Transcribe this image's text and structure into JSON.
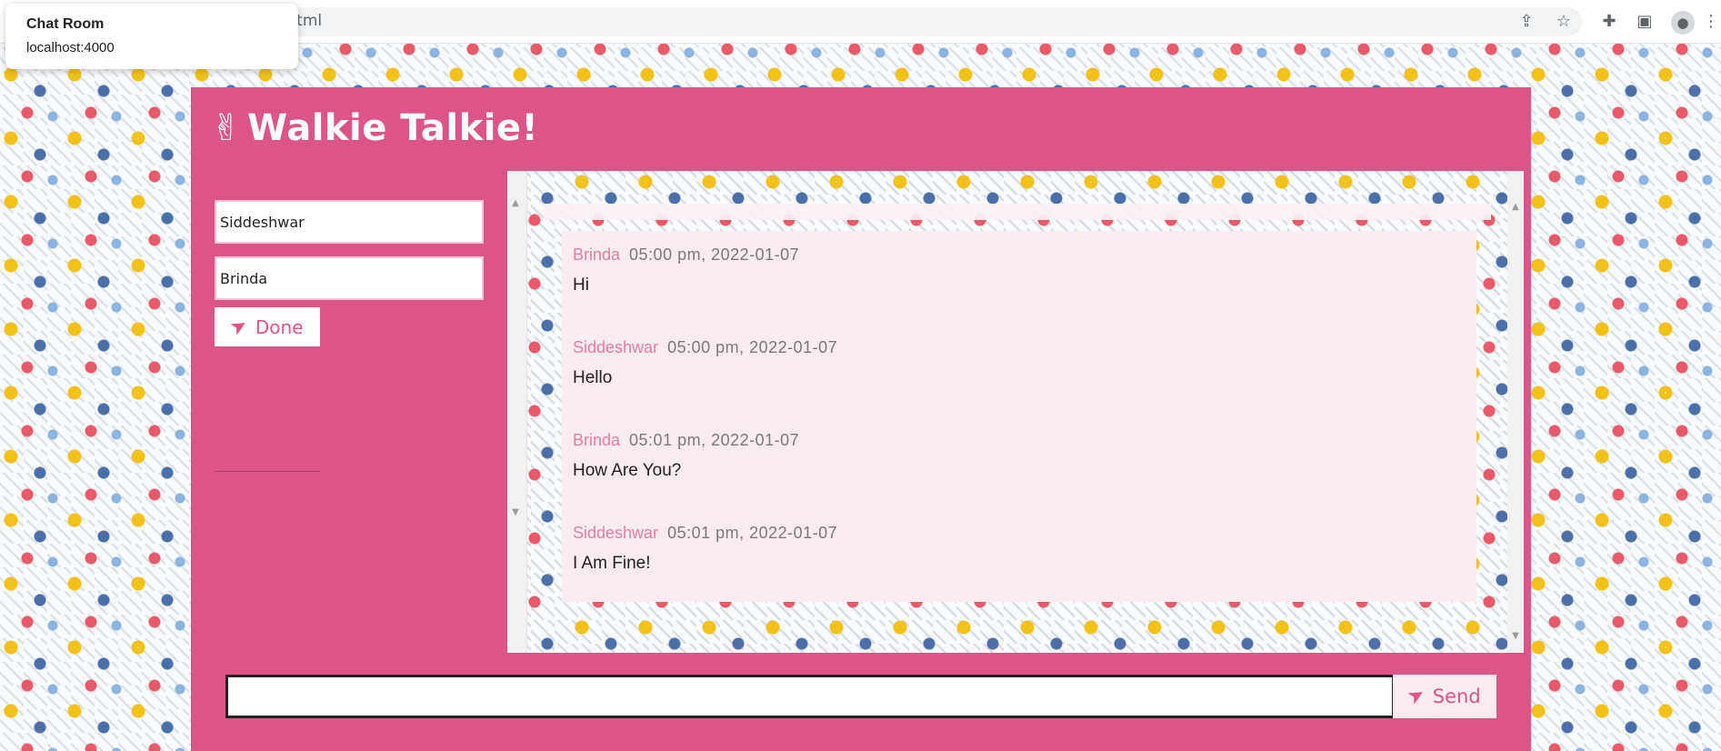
{
  "browser": {
    "address_suffix": ".html",
    "tooltip": {
      "title": "Chat Room",
      "url": "localhost:4000"
    },
    "icons": [
      "share-icon",
      "star-icon",
      "extensions-icon",
      "side-panel-icon",
      "profile-icon",
      "menu-icon"
    ]
  },
  "app": {
    "title": "Walkie Talkie!",
    "logo_icon": "peace-hand-icon",
    "accent_color": "#dd5588",
    "sender_field": {
      "value": "Siddeshwar"
    },
    "receiver_field": {
      "value": "Brinda"
    },
    "done_button": {
      "label": "Done",
      "icon": "send-icon"
    },
    "messages": [
      {
        "name": "Brinda",
        "time": "05:00 pm, 2022-01-07",
        "text": "Hi"
      },
      {
        "name": "Siddeshwar",
        "time": "05:00 pm, 2022-01-07",
        "text": "Hello"
      },
      {
        "name": "Brinda",
        "time": "05:01 pm, 2022-01-07",
        "text": "How Are You?"
      },
      {
        "name": "Siddeshwar",
        "time": "05:01 pm, 2022-01-07",
        "text": "I Am Fine!"
      }
    ],
    "message_input": {
      "value": ""
    },
    "send_button": {
      "label": "Send",
      "icon": "send-icon"
    }
  }
}
